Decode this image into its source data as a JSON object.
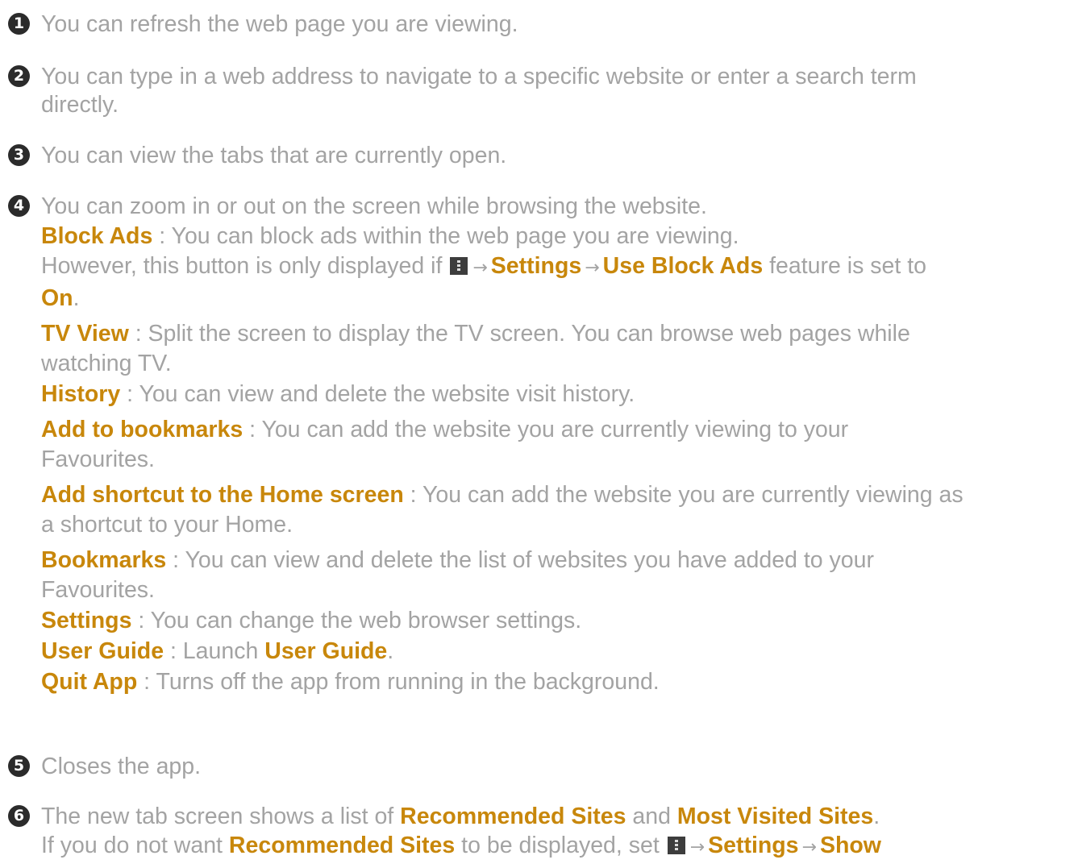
{
  "items": [
    {
      "number": "1",
      "text": "You can refresh the web page you are viewing."
    },
    {
      "number": "2",
      "text_line1": "You can type in a web address to navigate to a specific website or enter a search term",
      "text_line2": "directly."
    },
    {
      "number": "3",
      "text": "You can view the tabs that are currently open."
    },
    {
      "number": "4",
      "text": "You can zoom in or out on the screen while browsing the website.",
      "block_ads": {
        "label": "Block Ads",
        "desc": " : You can block ads within the web page you are viewing.",
        "note_prefix": "However, this button is only displayed if ",
        "settings": "Settings",
        "use_block_ads": "Use Block Ads",
        "note_mid": " feature is set to",
        "on": "On",
        "period": "."
      },
      "tv_view": {
        "label": "TV View",
        "desc_line1": " : Split the screen to display the TV screen. You can browse web pages while",
        "desc_line2": "watching TV."
      },
      "history": {
        "label": "History",
        "desc": " : You can view and delete the website visit history."
      },
      "add_bookmarks": {
        "label": "Add to bookmarks",
        "desc_line1": " : You can add the website you are currently viewing to your",
        "desc_line2": "Favourites."
      },
      "add_shortcut": {
        "label": "Add shortcut to the Home screen",
        "desc_line1": " : You can add the website you are currently viewing as",
        "desc_line2": "a shortcut to your Home."
      },
      "bookmarks": {
        "label": "Bookmarks",
        "desc_line1": " : You can view and delete the list of websites you have added to your",
        "desc_line2": "Favourites."
      },
      "settings": {
        "label": "Settings",
        "desc": " : You can change the web browser settings."
      },
      "user_guide": {
        "label": "User Guide",
        "desc": " : Launch ",
        "link": "User Guide",
        "period": "."
      },
      "quit_app": {
        "label": "Quit App",
        "desc": " : Turns off the app from running in the background."
      }
    },
    {
      "number": "5",
      "text": "Closes the app."
    },
    {
      "number": "6",
      "text_prefix": "The new tab screen shows a list of ",
      "recommended": "Recommended Sites",
      "and": " and ",
      "most_visited": "Most Visited Sites",
      "period": ".",
      "line2_prefix": "If you do not want ",
      "recommended2": "Recommended Sites",
      "line2_mid": " to be displayed, set ",
      "settings": "Settings",
      "show": "Show"
    }
  ],
  "icons": {
    "menu": "menu-dots-icon",
    "arrow": "→"
  },
  "colors": {
    "text": "#a3a3a3",
    "highlight": "#c8870b",
    "badge": "#2b2b2b"
  }
}
